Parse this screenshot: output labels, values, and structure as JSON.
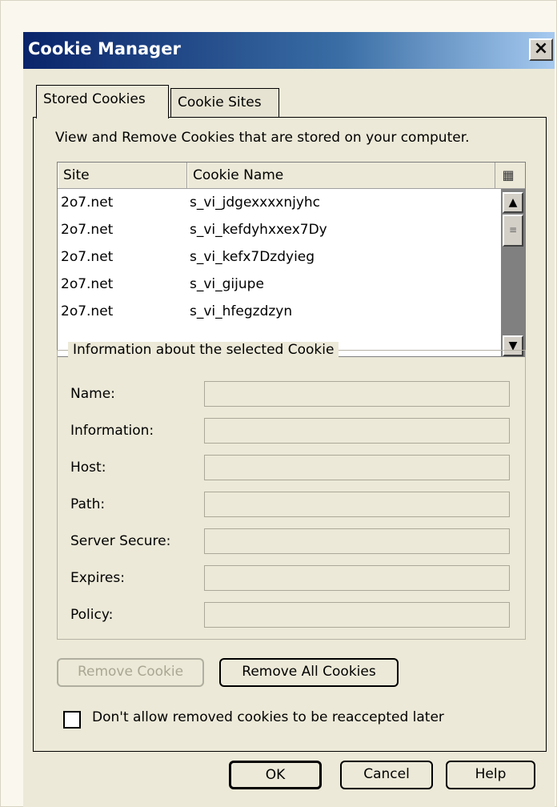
{
  "window": {
    "title": "Cookie Manager",
    "close_glyph": "×"
  },
  "tabs": [
    {
      "label": "Stored Cookies",
      "active": true
    },
    {
      "label": "Cookie Sites",
      "active": false
    }
  ],
  "intro_text": "View and Remove Cookies that are stored on your computer.",
  "cookie_list": {
    "columns": [
      "Site",
      "Cookie Name"
    ],
    "column_picker_icon": "column-picker-icon",
    "rows": [
      {
        "site": "2o7.net",
        "name": "s_vi_jdgexxxxnjyhc"
      },
      {
        "site": "2o7.net",
        "name": "s_vi_kefdyhxxex7Dy"
      },
      {
        "site": "2o7.net",
        "name": "s_vi_kefx7Dzdyieg"
      },
      {
        "site": "2o7.net",
        "name": "s_vi_gijupe"
      },
      {
        "site": "2o7.net",
        "name": "s_vi_hfegzdzyn"
      }
    ]
  },
  "info_group": {
    "legend": "Information about the selected Cookie",
    "fields": [
      {
        "label": "Name:",
        "value": ""
      },
      {
        "label": "Information:",
        "value": ""
      },
      {
        "label": "Host:",
        "value": ""
      },
      {
        "label": "Path:",
        "value": ""
      },
      {
        "label": "Server Secure:",
        "value": ""
      },
      {
        "label": "Expires:",
        "value": ""
      },
      {
        "label": "Policy:",
        "value": ""
      }
    ]
  },
  "buttons": {
    "remove_cookie": "Remove Cookie",
    "remove_all": "Remove All Cookies",
    "ok": "OK",
    "cancel": "Cancel",
    "help": "Help"
  },
  "checkbox": {
    "label": "Don't allow removed cookies to be reaccepted later",
    "checked": false
  }
}
